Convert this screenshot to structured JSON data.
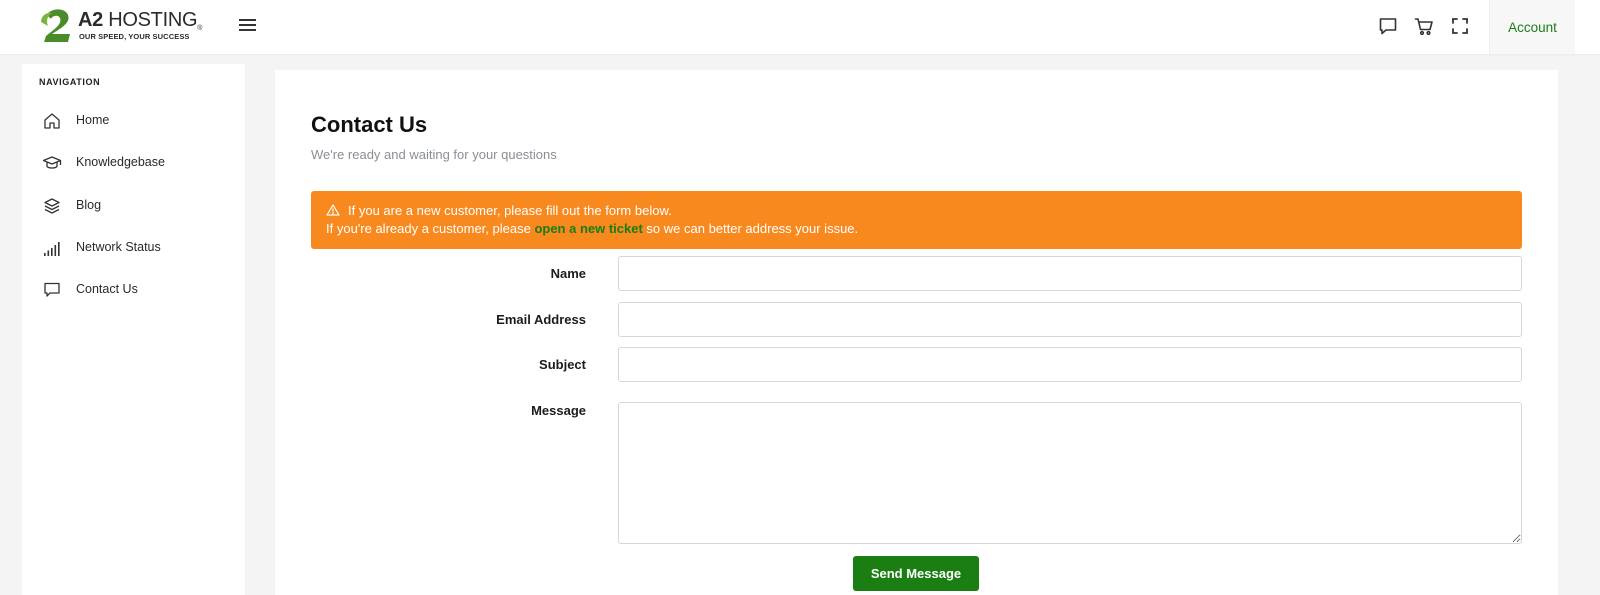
{
  "brand": {
    "name_bold": "A2",
    "name_rest": " HOSTING",
    "registered": "®",
    "tagline": "OUR SPEED, YOUR SUCCESS",
    "colors": {
      "green": "#4a8c2a",
      "dark": "#2b2b2b"
    }
  },
  "header": {
    "menu_icon": "hamburger-menu-icon",
    "icons": [
      "chat-icon",
      "cart-icon",
      "fullscreen-icon"
    ],
    "account_label": "Account"
  },
  "sidebar": {
    "title": "NAVIGATION",
    "items": [
      {
        "label": "Home",
        "icon": "home-icon"
      },
      {
        "label": "Knowledgebase",
        "icon": "graduation-cap-icon"
      },
      {
        "label": "Blog",
        "icon": "layers-icon"
      },
      {
        "label": "Network Status",
        "icon": "signal-bars-icon"
      },
      {
        "label": "Contact Us",
        "icon": "chat-icon"
      }
    ]
  },
  "main": {
    "title": "Contact Us",
    "subtitle": "We're ready and waiting for your questions",
    "alert": {
      "icon": "warning-icon",
      "line1": "If you are a new customer, please fill out the form below.",
      "line2_prefix": "If you're already a customer, please ",
      "link_text": "open a new ticket",
      "line2_suffix": " so we can better address your issue."
    },
    "form": {
      "name_label": "Name",
      "email_label": "Email Address",
      "subject_label": "Subject",
      "message_label": "Message",
      "name_value": "",
      "email_value": "",
      "subject_value": "",
      "message_value": "",
      "submit_label": "Send Message"
    }
  },
  "colors": {
    "accent_green": "#1b7e13",
    "alert_orange": "#f7891e",
    "page_background": "#f4f4f4",
    "subtitle_gray": "#8a8f96"
  }
}
